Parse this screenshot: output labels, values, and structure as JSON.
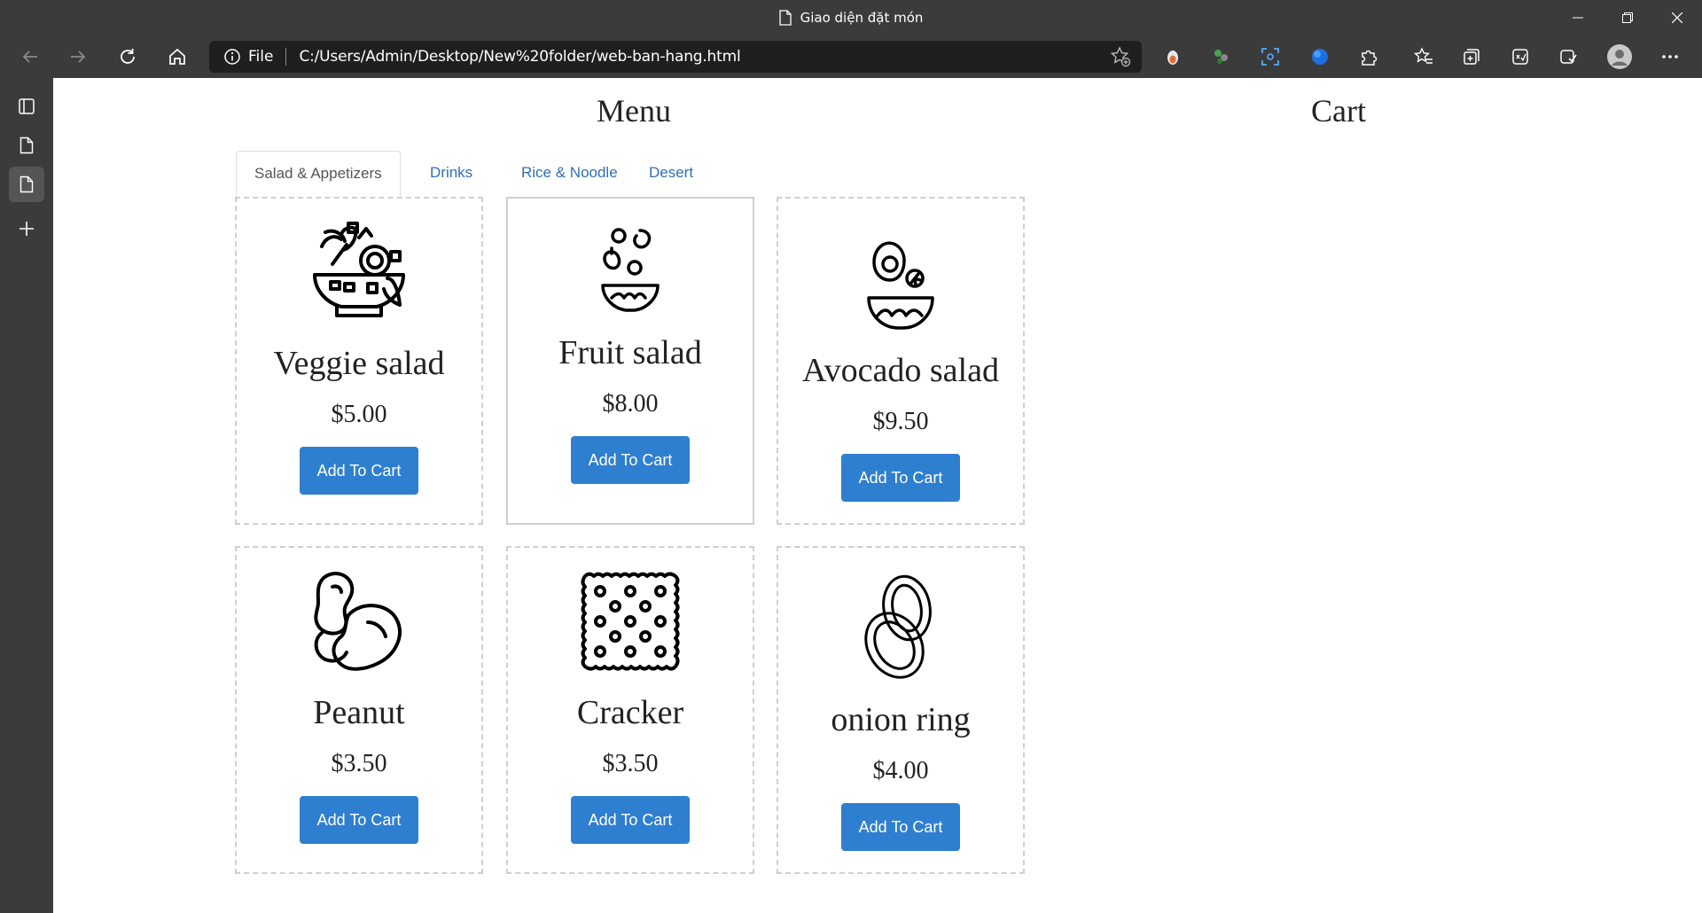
{
  "browser": {
    "window_title": "Giao diện đặt món",
    "address_label": "File",
    "url": "C:/Users/Admin/Desktop/New%20folder/web-ban-hang.html"
  },
  "menu": {
    "title": "Menu",
    "tabs": [
      {
        "label": "Salad & Appetizers"
      },
      {
        "label": "Drinks"
      },
      {
        "label": "Rice & Noodle"
      },
      {
        "label": "Desert"
      }
    ],
    "items": [
      {
        "name": "Veggie salad",
        "price": "$5.00",
        "button": "Add To Cart",
        "icon": "salad-bowl-icon"
      },
      {
        "name": "Fruit salad",
        "price": "$8.00",
        "button": "Add To Cart",
        "icon": "fruit-bowl-icon"
      },
      {
        "name": "Avocado salad",
        "price": "$9.50",
        "button": "Add To Cart",
        "icon": "avocado-bowl-icon"
      },
      {
        "name": "Peanut",
        "price": "$3.50",
        "button": "Add To Cart",
        "icon": "peanut-icon"
      },
      {
        "name": "Cracker",
        "price": "$3.50",
        "button": "Add To Cart",
        "icon": "cracker-icon"
      },
      {
        "name": "onion ring",
        "price": "$4.00",
        "button": "Add To Cart",
        "icon": "onion-ring-icon"
      }
    ]
  },
  "cart": {
    "title": "Cart"
  },
  "colors": {
    "chrome": "#3b3b3b",
    "address_bg": "#1f1f1f",
    "button": "#2f7fd0",
    "tab_link": "#2f6fb7"
  }
}
